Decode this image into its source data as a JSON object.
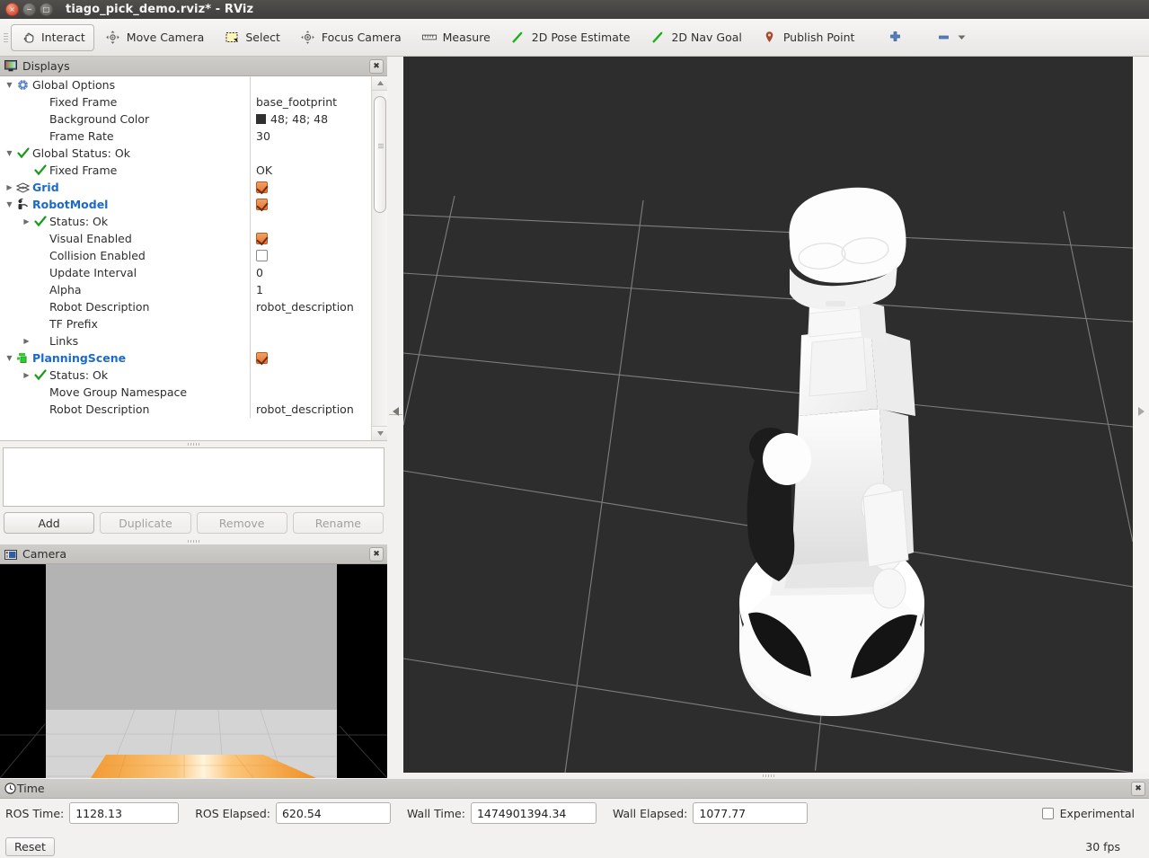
{
  "window": {
    "title": "tiago_pick_demo.rviz* - RViz",
    "buttons": {
      "close": "×",
      "minimize": "−",
      "maximize": "□"
    }
  },
  "toolbar": {
    "items": [
      {
        "label": "Interact",
        "icon": "hand-cursor-icon",
        "active": true
      },
      {
        "label": "Move Camera",
        "icon": "move-camera-icon",
        "active": false
      },
      {
        "label": "Select",
        "icon": "select-rectangle-icon",
        "active": false
      },
      {
        "label": "Focus Camera",
        "icon": "focus-camera-icon",
        "active": false
      },
      {
        "label": "Measure",
        "icon": "ruler-icon",
        "active": false
      },
      {
        "label": "2D Pose Estimate",
        "icon": "pose-arrow-icon",
        "active": false
      },
      {
        "label": "2D Nav Goal",
        "icon": "nav-goal-arrow-icon",
        "active": false
      },
      {
        "label": "Publish Point",
        "icon": "map-pin-icon",
        "active": false
      }
    ],
    "add_tool_icon": "plus-icon",
    "remove_tool_icon": "minus-icon",
    "overflow_icon": "chevron-down-icon"
  },
  "displays_panel": {
    "title": "Displays",
    "close_icon": "✖",
    "tree": [
      {
        "indent": 0,
        "arrow": "down",
        "icon": "gear-icon",
        "name": "Global Options",
        "value": "",
        "value_type": "text",
        "bold_blue": false
      },
      {
        "indent": 1,
        "arrow": "none",
        "icon": "none",
        "name": "Fixed Frame",
        "value": "base_footprint",
        "value_type": "text",
        "bold_blue": false
      },
      {
        "indent": 1,
        "arrow": "none",
        "icon": "none",
        "name": "Background Color",
        "value": "48; 48; 48",
        "value_type": "color",
        "swatch": "#303030",
        "bold_blue": false
      },
      {
        "indent": 1,
        "arrow": "none",
        "icon": "none",
        "name": "Frame Rate",
        "value": "30",
        "value_type": "text",
        "bold_blue": false
      },
      {
        "indent": 0,
        "arrow": "down",
        "icon": "status-ok-icon",
        "name": "Global Status: Ok",
        "value": "",
        "value_type": "text",
        "bold_blue": false
      },
      {
        "indent": 1,
        "arrow": "none",
        "icon": "status-ok-icon",
        "name": "Fixed Frame",
        "value": "OK",
        "value_type": "text",
        "bold_blue": false
      },
      {
        "indent": 0,
        "arrow": "right",
        "icon": "grid-icon",
        "name": "Grid",
        "value": "",
        "value_type": "checkbox-on",
        "bold_blue": true
      },
      {
        "indent": 0,
        "arrow": "down",
        "icon": "robot-model-icon",
        "name": "RobotModel",
        "value": "",
        "value_type": "checkbox-on",
        "bold_blue": true
      },
      {
        "indent": 1,
        "arrow": "right",
        "icon": "status-ok-icon",
        "name": "Status: Ok",
        "value": "",
        "value_type": "text",
        "bold_blue": false
      },
      {
        "indent": 1,
        "arrow": "none",
        "icon": "none",
        "name": "Visual Enabled",
        "value": "",
        "value_type": "checkbox-on",
        "bold_blue": false
      },
      {
        "indent": 1,
        "arrow": "none",
        "icon": "none",
        "name": "Collision Enabled",
        "value": "",
        "value_type": "checkbox-off",
        "bold_blue": false
      },
      {
        "indent": 1,
        "arrow": "none",
        "icon": "none",
        "name": "Update Interval",
        "value": "0",
        "value_type": "text",
        "bold_blue": false
      },
      {
        "indent": 1,
        "arrow": "none",
        "icon": "none",
        "name": "Alpha",
        "value": "1",
        "value_type": "text",
        "bold_blue": false
      },
      {
        "indent": 1,
        "arrow": "none",
        "icon": "none",
        "name": "Robot Description",
        "value": "robot_description",
        "value_type": "text",
        "bold_blue": false
      },
      {
        "indent": 1,
        "arrow": "none",
        "icon": "none",
        "name": "TF Prefix",
        "value": "",
        "value_type": "text",
        "bold_blue": false
      },
      {
        "indent": 1,
        "arrow": "right",
        "icon": "none",
        "name": "Links",
        "value": "",
        "value_type": "text",
        "bold_blue": false
      },
      {
        "indent": 0,
        "arrow": "down",
        "icon": "planning-scene-icon",
        "name": "PlanningScene",
        "value": "",
        "value_type": "checkbox-on",
        "bold_blue": true
      },
      {
        "indent": 1,
        "arrow": "right",
        "icon": "status-ok-icon",
        "name": "Status: Ok",
        "value": "",
        "value_type": "text",
        "bold_blue": false
      },
      {
        "indent": 1,
        "arrow": "none",
        "icon": "none",
        "name": "Move Group Namespace",
        "value": "",
        "value_type": "text",
        "bold_blue": false
      },
      {
        "indent": 1,
        "arrow": "none",
        "icon": "none",
        "name": "Robot Description",
        "value": "robot_description",
        "value_type": "text",
        "bold_blue": false
      }
    ],
    "description_text": "",
    "buttons": [
      {
        "label": "Add",
        "enabled": true
      },
      {
        "label": "Duplicate",
        "enabled": false
      },
      {
        "label": "Remove",
        "enabled": false
      },
      {
        "label": "Rename",
        "enabled": false
      }
    ]
  },
  "camera_panel": {
    "title": "Camera",
    "icon": "camera-icon",
    "close_icon": "✖"
  },
  "time_panel": {
    "title": "Time",
    "icon": "clock-icon",
    "close_icon": "✖",
    "fields": [
      {
        "label": "ROS Time:",
        "value": "1128.13"
      },
      {
        "label": "ROS Elapsed:",
        "value": "620.54"
      },
      {
        "label": "Wall Time:",
        "value": "1474901394.34"
      },
      {
        "label": "Wall Elapsed:",
        "value": "1077.77"
      }
    ],
    "experimental": {
      "label": "Experimental",
      "checked": false
    }
  },
  "status_bar": {
    "reset_label": "Reset",
    "fps": "30 fps"
  },
  "colors": {
    "view_background": "#2d2d2d",
    "grid_line": "#9a9a9a",
    "accent_blue": "#1a6acc",
    "check_orange": "#e8743a",
    "ok_green": "#1a9b1a"
  }
}
